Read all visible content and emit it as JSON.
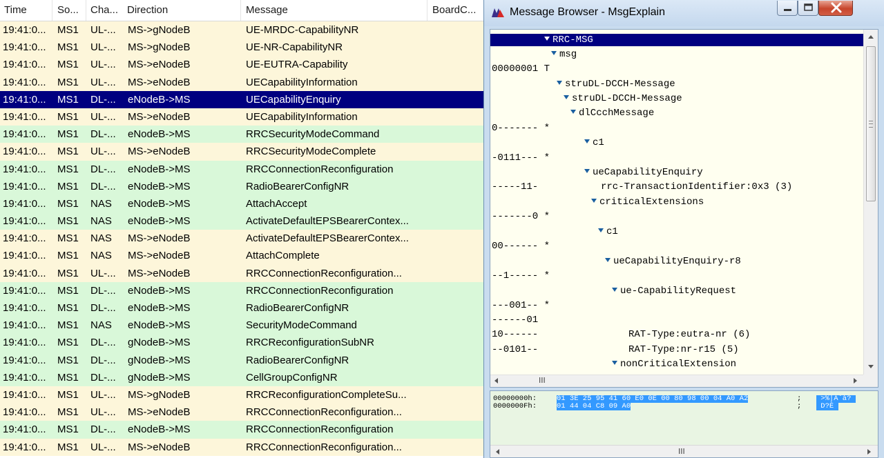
{
  "log": {
    "columns": [
      "Time",
      "So...",
      "Cha...",
      "Direction",
      "Message",
      "BoardC..."
    ],
    "rows": [
      {
        "time": "19:41:0...",
        "src": "MS1",
        "ch": "UL-...",
        "dir": "MS->gNodeB",
        "msg": "UE-MRDC-CapabilityNR",
        "kind": "ul"
      },
      {
        "time": "19:41:0...",
        "src": "MS1",
        "ch": "UL-...",
        "dir": "MS->gNodeB",
        "msg": "UE-NR-CapabilityNR",
        "kind": "ul"
      },
      {
        "time": "19:41:0...",
        "src": "MS1",
        "ch": "UL-...",
        "dir": "MS->eNodeB",
        "msg": "UE-EUTRA-Capability",
        "kind": "ul"
      },
      {
        "time": "19:41:0...",
        "src": "MS1",
        "ch": "UL-...",
        "dir": "MS->eNodeB",
        "msg": "UECapabilityInformation",
        "kind": "ul"
      },
      {
        "time": "19:41:0...",
        "src": "MS1",
        "ch": "DL-...",
        "dir": "eNodeB->MS",
        "msg": "UECapabilityEnquiry",
        "kind": "sel"
      },
      {
        "time": "19:41:0...",
        "src": "MS1",
        "ch": "UL-...",
        "dir": "MS->eNodeB",
        "msg": "UECapabilityInformation",
        "kind": "ul"
      },
      {
        "time": "19:41:0...",
        "src": "MS1",
        "ch": "DL-...",
        "dir": "eNodeB->MS",
        "msg": "RRCSecurityModeCommand",
        "kind": "dl"
      },
      {
        "time": "19:41:0...",
        "src": "MS1",
        "ch": "UL-...",
        "dir": "MS->eNodeB",
        "msg": "RRCSecurityModeComplete",
        "kind": "ul"
      },
      {
        "time": "19:41:0...",
        "src": "MS1",
        "ch": "DL-...",
        "dir": "eNodeB->MS",
        "msg": "RRCConnectionReconfiguration",
        "kind": "dl"
      },
      {
        "time": "19:41:0...",
        "src": "MS1",
        "ch": "DL-...",
        "dir": "eNodeB->MS",
        "msg": "RadioBearerConfigNR",
        "kind": "dl"
      },
      {
        "time": "19:41:0...",
        "src": "MS1",
        "ch": "NAS",
        "dir": "eNodeB->MS",
        "msg": "AttachAccept",
        "kind": "dl"
      },
      {
        "time": "19:41:0...",
        "src": "MS1",
        "ch": "NAS",
        "dir": "eNodeB->MS",
        "msg": "ActivateDefaultEPSBearerContex...",
        "kind": "dl"
      },
      {
        "time": "19:41:0...",
        "src": "MS1",
        "ch": "NAS",
        "dir": "MS->eNodeB",
        "msg": "ActivateDefaultEPSBearerContex...",
        "kind": "ul"
      },
      {
        "time": "19:41:0...",
        "src": "MS1",
        "ch": "NAS",
        "dir": "MS->eNodeB",
        "msg": "AttachComplete",
        "kind": "ul"
      },
      {
        "time": "19:41:0...",
        "src": "MS1",
        "ch": "UL-...",
        "dir": "MS->eNodeB",
        "msg": "RRCConnectionReconfiguration...",
        "kind": "ul"
      },
      {
        "time": "19:41:0...",
        "src": "MS1",
        "ch": "DL-...",
        "dir": "eNodeB->MS",
        "msg": "RRCConnectionReconfiguration",
        "kind": "dl"
      },
      {
        "time": "19:41:0...",
        "src": "MS1",
        "ch": "DL-...",
        "dir": "eNodeB->MS",
        "msg": "RadioBearerConfigNR",
        "kind": "dl"
      },
      {
        "time": "19:41:0...",
        "src": "MS1",
        "ch": "NAS",
        "dir": "eNodeB->MS",
        "msg": "SecurityModeCommand",
        "kind": "dl"
      },
      {
        "time": "19:41:0...",
        "src": "MS1",
        "ch": "DL-...",
        "dir": "gNodeB->MS",
        "msg": "RRCReconfigurationSubNR",
        "kind": "dl"
      },
      {
        "time": "19:41:0...",
        "src": "MS1",
        "ch": "DL-...",
        "dir": "gNodeB->MS",
        "msg": "RadioBearerConfigNR",
        "kind": "dl"
      },
      {
        "time": "19:41:0...",
        "src": "MS1",
        "ch": "DL-...",
        "dir": "gNodeB->MS",
        "msg": "CellGroupConfigNR",
        "kind": "dl"
      },
      {
        "time": "19:41:0...",
        "src": "MS1",
        "ch": "UL-...",
        "dir": "MS->gNodeB",
        "msg": "RRCReconfigurationCompleteSu...",
        "kind": "ul"
      },
      {
        "time": "19:41:0...",
        "src": "MS1",
        "ch": "UL-...",
        "dir": "MS->eNodeB",
        "msg": "RRCConnectionReconfiguration...",
        "kind": "ul"
      },
      {
        "time": "19:41:0...",
        "src": "MS1",
        "ch": "DL-...",
        "dir": "eNodeB->MS",
        "msg": "RRCConnectionReconfiguration",
        "kind": "dl"
      },
      {
        "time": "19:41:0...",
        "src": "MS1",
        "ch": "UL-...",
        "dir": "MS->eNodeB",
        "msg": "RRCConnectionReconfiguration...",
        "kind": "ul"
      }
    ]
  },
  "window": {
    "title": "Message Browser - MsgExplain",
    "colors": {
      "titlebar": "#c4d8ee",
      "selection": "#000080",
      "close": "#c7452c"
    }
  },
  "tree": {
    "lines": [
      {
        "bits": "",
        "label": "RRC-MSG",
        "tri": true,
        "sel": true
      },
      {
        "bits": "",
        "label": "msg",
        "tri": true
      },
      {
        "bits": "00000001 T",
        "label": "",
        "tri": false
      },
      {
        "bits": "",
        "label": "struDL-DCCH-Message",
        "tri": true
      },
      {
        "bits": "",
        "label": "struDL-DCCH-Message",
        "tri": true
      },
      {
        "bits": "",
        "label": "dlCcchMessage",
        "tri": true
      },
      {
        "bits": "0------- *",
        "label": "",
        "tri": false
      },
      {
        "bits": "",
        "label": "c1",
        "tri": true
      },
      {
        "bits": "-0111--- *",
        "label": "",
        "tri": false
      },
      {
        "bits": "",
        "label": "ueCapabilityEnquiry",
        "tri": true
      },
      {
        "bits": "-----11-",
        "label": "rrc-TransactionIdentifier:0x3 (3)",
        "tri": false
      },
      {
        "bits": "",
        "label": "criticalExtensions",
        "tri": true
      },
      {
        "bits": "-------0 *",
        "label": "",
        "tri": false
      },
      {
        "bits": "",
        "label": "c1",
        "tri": true
      },
      {
        "bits": "00------ *",
        "label": "",
        "tri": false
      },
      {
        "bits": "",
        "label": "ueCapabilityEnquiry-r8",
        "tri": true
      },
      {
        "bits": "--1----- *",
        "label": "",
        "tri": false
      },
      {
        "bits": "",
        "label": "ue-CapabilityRequest",
        "tri": true
      },
      {
        "bits": "---001-- *",
        "label": "",
        "tri": false
      },
      {
        "bits": "------01",
        "label": "",
        "tri": false
      },
      {
        "bits": "10------",
        "label": "RAT-Type:eutra-nr (6)",
        "tri": false
      },
      {
        "bits": "--0101--",
        "label": "RAT-Type:nr-r15 (5)",
        "tri": false
      },
      {
        "bits": "",
        "label": "nonCriticalExtension",
        "tri": true
      }
    ]
  },
  "hex": {
    "lines": [
      {
        "addr": "00000000h:",
        "bytes": "01 3E 25 95 41 60 E0 0E 00 80 98 00 04 A0 A2",
        "sep": ";",
        "ascii": " >%|A`à? "
      },
      {
        "addr": "0000000Fh:",
        "bytes": "01 44 04 C8 09 A0",
        "sep": ";",
        "ascii": " D?È "
      }
    ]
  },
  "scroll": {
    "grip": "III"
  }
}
